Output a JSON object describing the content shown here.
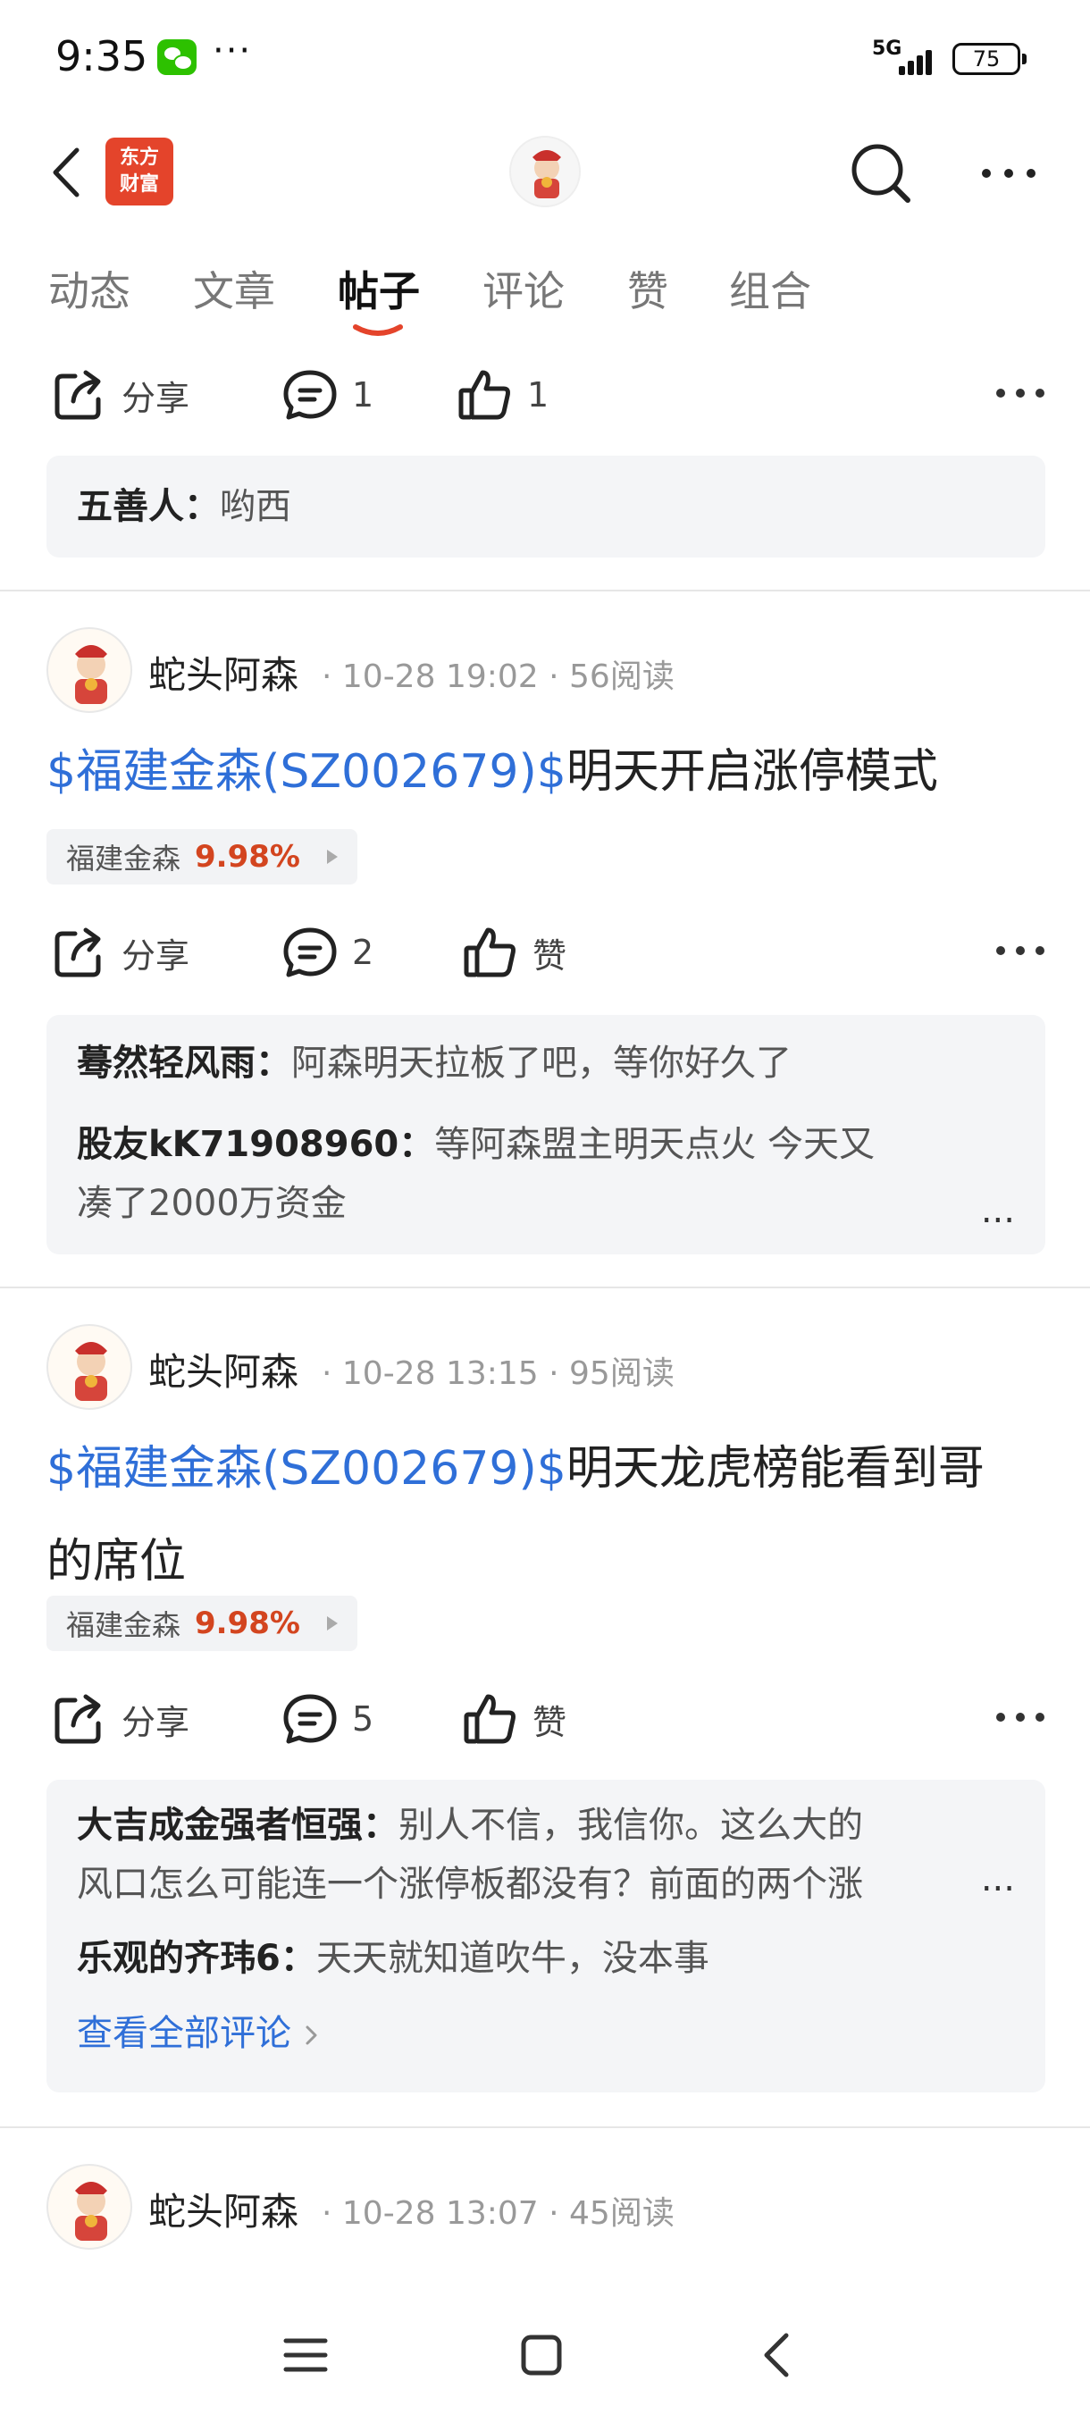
{
  "status_bar": {
    "time": "9:35",
    "more": "···",
    "network": "5G",
    "battery": "75",
    "icons": [
      "wechat-icon",
      "signal-icon",
      "battery-icon"
    ]
  },
  "header": {
    "logo_text_line1": "东方",
    "logo_text_line2": "财富",
    "icons": [
      "back-icon",
      "search-icon",
      "more-icon"
    ],
    "accent_color": "#e4442b"
  },
  "tabs": [
    {
      "label": "动态",
      "active": false
    },
    {
      "label": "文章",
      "active": false
    },
    {
      "label": "帖子",
      "active": true
    },
    {
      "label": "评论",
      "active": false
    },
    {
      "label": "赞",
      "active": false
    },
    {
      "label": "组合",
      "active": false
    }
  ],
  "top_fragment": {
    "actions": {
      "share": "分享",
      "comment_count": "1",
      "like_count": "1"
    },
    "comments": [
      {
        "user": "五善人：",
        "text": "哟西"
      }
    ]
  },
  "posts": [
    {
      "author": "蛇头阿森",
      "meta": "· 10-28 19:02 · 56阅读",
      "title_stock": "$福建金森(SZ002679)$",
      "title_text": "明天开启涨停模式",
      "tag_name": "福建金森",
      "tag_pct": "9.98%",
      "actions": {
        "share": "分享",
        "comment_count": "2",
        "like": "赞"
      },
      "comments": [
        {
          "user": "蓦然轻风雨：",
          "text": "阿森明天拉板了吧，等你好久了"
        },
        {
          "user": "股友kK71908960：",
          "text": "等阿森盟主明天点火 今天又",
          "text2": "凑了2000万资金"
        }
      ],
      "ellipsis": "..."
    },
    {
      "author": "蛇头阿森",
      "meta": "· 10-28 13:15 · 95阅读",
      "title_stock": "$福建金森(SZ002679)$",
      "title_text": "明天龙虎榜能看到哥",
      "title_text2": "的席位",
      "tag_name": "福建金森",
      "tag_pct": "9.98%",
      "actions": {
        "share": "分享",
        "comment_count": "5",
        "like": "赞"
      },
      "comments": [
        {
          "user": "大吉成金强者恒强：",
          "text": "别人不信，我信你。这么大的",
          "text2": "风口怎么可能连一个涨停板都没有？前面的两个涨"
        },
        {
          "user": "乐观的齐玮6：",
          "text": "天天就知道吹牛，没本事"
        }
      ],
      "ellipsis": "...",
      "view_all": "查看全部评论"
    },
    {
      "author": "蛇头阿森",
      "meta": "· 10-28 13:07 · 45阅读"
    }
  ],
  "colors": {
    "link_blue": "#2f6fd8",
    "up_red": "#d3451f",
    "tab_underline": "#e4442b"
  },
  "navbar": {
    "icons": [
      "menu-icon",
      "home-square-icon",
      "back-triangle-icon"
    ]
  }
}
